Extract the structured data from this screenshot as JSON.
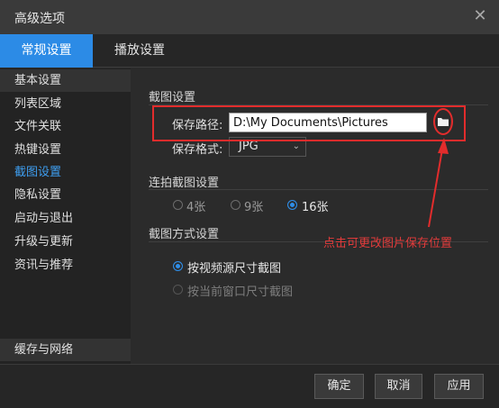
{
  "window": {
    "title": "高级选项",
    "close_glyph": "✕"
  },
  "tabs": [
    {
      "label": "常规设置",
      "active": true
    },
    {
      "label": "播放设置",
      "active": false
    }
  ],
  "sidebar": {
    "items": [
      {
        "label": "基本设置"
      },
      {
        "label": "列表区域"
      },
      {
        "label": "文件关联"
      },
      {
        "label": "热键设置"
      },
      {
        "label": "截图设置",
        "active": true
      },
      {
        "label": "隐私设置"
      },
      {
        "label": "启动与退出"
      },
      {
        "label": "升级与更新"
      },
      {
        "label": "资讯与推荐"
      }
    ],
    "bottom_item": {
      "label": "缓存与网络"
    }
  },
  "screenshot_settings": {
    "section_title": "截图设置",
    "save_path_label": "保存路径:",
    "save_path_value": "D:\\My Documents\\Pictures",
    "folder_icon": "folder-icon",
    "save_format_label": "保存格式:",
    "save_format_value": "JPG"
  },
  "burst_settings": {
    "section_title": "连拍截图设置",
    "options": [
      {
        "label": "4张",
        "selected": false
      },
      {
        "label": "9张",
        "selected": false
      },
      {
        "label": "16张",
        "selected": true
      }
    ]
  },
  "method_settings": {
    "section_title": "截图方式设置",
    "options": [
      {
        "label": "按视频源尺寸截图",
        "selected": true,
        "enabled": true
      },
      {
        "label": "按当前窗口尺寸截图",
        "selected": false,
        "enabled": false
      }
    ]
  },
  "annotation": {
    "text": "点击可更改图片保存位置",
    "color": "#e23b3b"
  },
  "footer": {
    "ok_label": "确定",
    "cancel_label": "取消",
    "apply_label": "应用"
  },
  "colors": {
    "accent": "#2c8be6",
    "active_text": "#3e9ef0",
    "highlight_red": "#e22c2c"
  }
}
